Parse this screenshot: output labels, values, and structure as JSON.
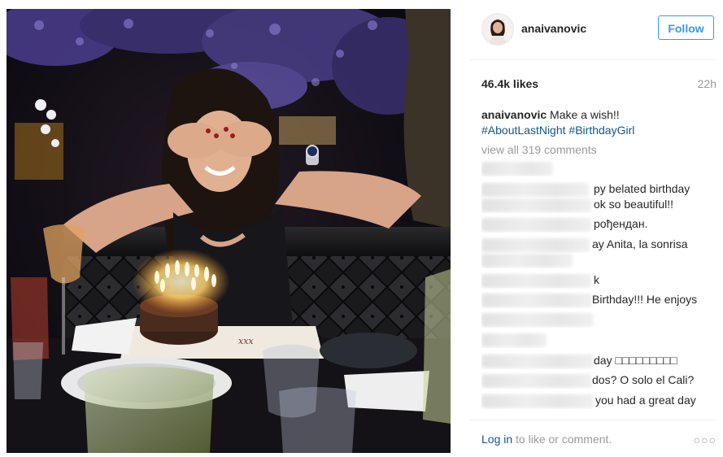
{
  "post": {
    "username": "anaivanovic",
    "follow_label": "Follow",
    "likes": "46.4k likes",
    "time": "22h",
    "caption_text": " Make a wish!!",
    "hashtags": [
      "#AboutLastNight",
      "#BirthdayGirl"
    ],
    "view_all": "view all 319 comments"
  },
  "comments": [
    {
      "text": ""
    },
    {
      "text": "py belated birthday"
    },
    {
      "text": "ok so beautiful!!"
    },
    {
      "text": "рођендан."
    },
    {
      "text": "ay Anita, la sonrisa"
    },
    {
      "text": ""
    },
    {
      "text": "k"
    },
    {
      "text": "Birthday!!! He enjoys"
    },
    {
      "text": ""
    },
    {
      "text": ""
    },
    {
      "text": "day □□□□□□□□□"
    },
    {
      "text": "dos? O solo el Cali?"
    },
    {
      "text": "you had a great day"
    }
  ],
  "footer": {
    "login_link": "Log in",
    "login_rest": " to like or comment.",
    "more": "○○○"
  },
  "icons": {
    "options": "more-options-icon"
  },
  "colors": {
    "follow_blue": "#3897f0",
    "hashtag_blue": "#125688",
    "muted": "#999999"
  }
}
